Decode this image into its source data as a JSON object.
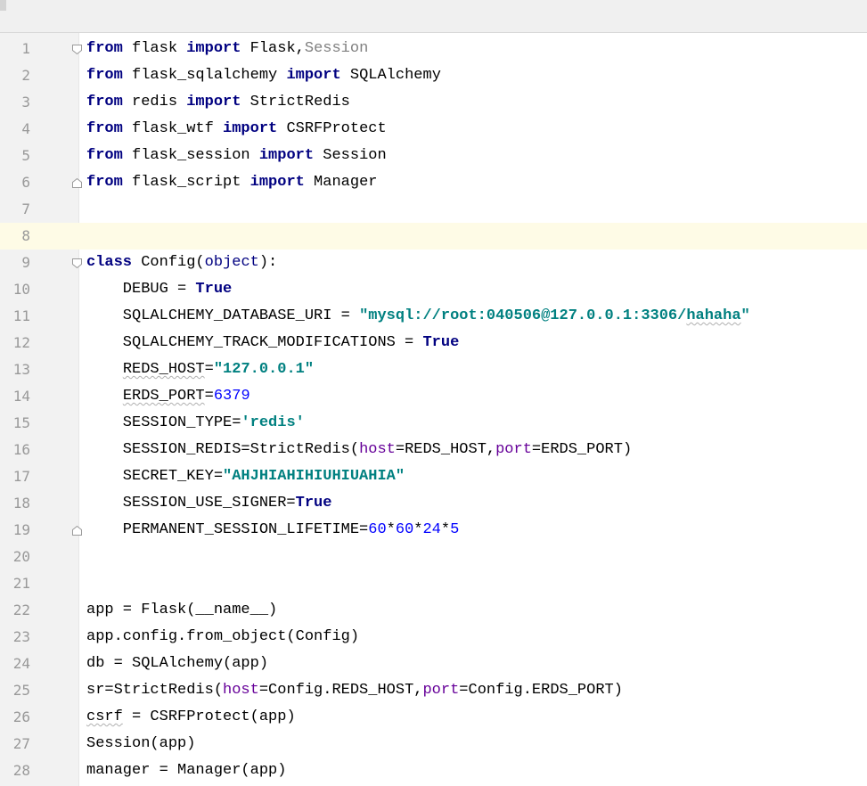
{
  "editor": {
    "lines": [
      {
        "n": "1",
        "tokens": [
          {
            "t": "from",
            "c": "kw"
          },
          {
            "t": " flask "
          },
          {
            "t": "import",
            "c": "kw"
          },
          {
            "t": " Flask"
          },
          {
            "t": ","
          },
          {
            "t": "Session",
            "c": "dim"
          }
        ],
        "fold": "start"
      },
      {
        "n": "2",
        "tokens": [
          {
            "t": "from",
            "c": "kw"
          },
          {
            "t": " flask_sqlalchemy "
          },
          {
            "t": "import",
            "c": "kw"
          },
          {
            "t": " SQLAlchemy"
          }
        ]
      },
      {
        "n": "3",
        "tokens": [
          {
            "t": "from",
            "c": "kw"
          },
          {
            "t": " redis "
          },
          {
            "t": "import",
            "c": "kw"
          },
          {
            "t": " StrictRedis"
          }
        ]
      },
      {
        "n": "4",
        "tokens": [
          {
            "t": "from",
            "c": "kw"
          },
          {
            "t": " flask_wtf "
          },
          {
            "t": "import",
            "c": "kw"
          },
          {
            "t": " CSRFProtect"
          }
        ]
      },
      {
        "n": "5",
        "tokens": [
          {
            "t": "from",
            "c": "kw"
          },
          {
            "t": " flask_session "
          },
          {
            "t": "import",
            "c": "kw"
          },
          {
            "t": " Session"
          }
        ]
      },
      {
        "n": "6",
        "tokens": [
          {
            "t": "from",
            "c": "kw"
          },
          {
            "t": " flask_script "
          },
          {
            "t": "import",
            "c": "kw"
          },
          {
            "t": " Manager"
          }
        ],
        "fold": "end"
      },
      {
        "n": "7",
        "tokens": []
      },
      {
        "n": "8",
        "tokens": [],
        "current": true
      },
      {
        "n": "9",
        "tokens": [
          {
            "t": "class",
            "c": "kw"
          },
          {
            "t": " Config("
          },
          {
            "t": "object",
            "c": "builtin"
          },
          {
            "t": "):"
          }
        ],
        "fold": "start"
      },
      {
        "n": "10",
        "tokens": [
          {
            "t": "    DEBUG = "
          },
          {
            "t": "True",
            "c": "kw"
          }
        ]
      },
      {
        "n": "11",
        "tokens": [
          {
            "t": "    SQLALCHEMY_DATABASE_URI = "
          },
          {
            "t": "\"mysql://root:040506@127.0.0.1:3306/",
            "c": "str"
          },
          {
            "t": "hahaha",
            "c": "str squig"
          },
          {
            "t": "\"",
            "c": "str"
          }
        ]
      },
      {
        "n": "12",
        "tokens": [
          {
            "t": "    SQLALCHEMY_TRACK_MODIFICATIONS = "
          },
          {
            "t": "True",
            "c": "kw"
          }
        ]
      },
      {
        "n": "13",
        "tokens": [
          {
            "t": "    "
          },
          {
            "t": "REDS_HOST",
            "c": "squig"
          },
          {
            "t": "="
          },
          {
            "t": "\"127.0.0.1\"",
            "c": "str"
          }
        ]
      },
      {
        "n": "14",
        "tokens": [
          {
            "t": "    "
          },
          {
            "t": "ERDS_PORT",
            "c": "squig"
          },
          {
            "t": "="
          },
          {
            "t": "6379",
            "c": "num"
          }
        ]
      },
      {
        "n": "15",
        "tokens": [
          {
            "t": "    SESSION_TYPE="
          },
          {
            "t": "'redis'",
            "c": "str"
          }
        ]
      },
      {
        "n": "16",
        "tokens": [
          {
            "t": "    SESSION_REDIS=StrictRedis("
          },
          {
            "t": "host",
            "c": "param"
          },
          {
            "t": "=REDS_HOST"
          },
          {
            "t": ","
          },
          {
            "t": "port",
            "c": "param"
          },
          {
            "t": "=ERDS_PORT)"
          }
        ]
      },
      {
        "n": "17",
        "tokens": [
          {
            "t": "    SECRET_KEY="
          },
          {
            "t": "\"AHJHIAHIHIUHIUAHIA\"",
            "c": "str"
          }
        ]
      },
      {
        "n": "18",
        "tokens": [
          {
            "t": "    SESSION_USE_SIGNER="
          },
          {
            "t": "True",
            "c": "kw"
          }
        ]
      },
      {
        "n": "19",
        "tokens": [
          {
            "t": "    PERMANENT_SESSION_LIFETIME="
          },
          {
            "t": "60",
            "c": "num"
          },
          {
            "t": "*"
          },
          {
            "t": "60",
            "c": "num"
          },
          {
            "t": "*"
          },
          {
            "t": "24",
            "c": "num"
          },
          {
            "t": "*"
          },
          {
            "t": "5",
            "c": "num"
          }
        ],
        "fold": "end"
      },
      {
        "n": "20",
        "tokens": []
      },
      {
        "n": "21",
        "tokens": []
      },
      {
        "n": "22",
        "tokens": [
          {
            "t": "app = Flask(__name__)"
          }
        ]
      },
      {
        "n": "23",
        "tokens": [
          {
            "t": "app.config.from_object(Config)"
          }
        ]
      },
      {
        "n": "24",
        "tokens": [
          {
            "t": "db = SQLAlchemy(app)"
          }
        ]
      },
      {
        "n": "25",
        "tokens": [
          {
            "t": "sr=StrictRedis("
          },
          {
            "t": "host",
            "c": "param"
          },
          {
            "t": "=Config.REDS_HOST"
          },
          {
            "t": ","
          },
          {
            "t": "port",
            "c": "param"
          },
          {
            "t": "=Config.ERDS_PORT)"
          }
        ]
      },
      {
        "n": "26",
        "tokens": [
          {
            "t": "csrf",
            "c": "squig"
          },
          {
            "t": " = CSRFProtect(app)"
          }
        ]
      },
      {
        "n": "27",
        "tokens": [
          {
            "t": "Session(app)"
          }
        ]
      },
      {
        "n": "28",
        "tokens": [
          {
            "t": "manager = Manager(app)"
          }
        ]
      }
    ]
  }
}
